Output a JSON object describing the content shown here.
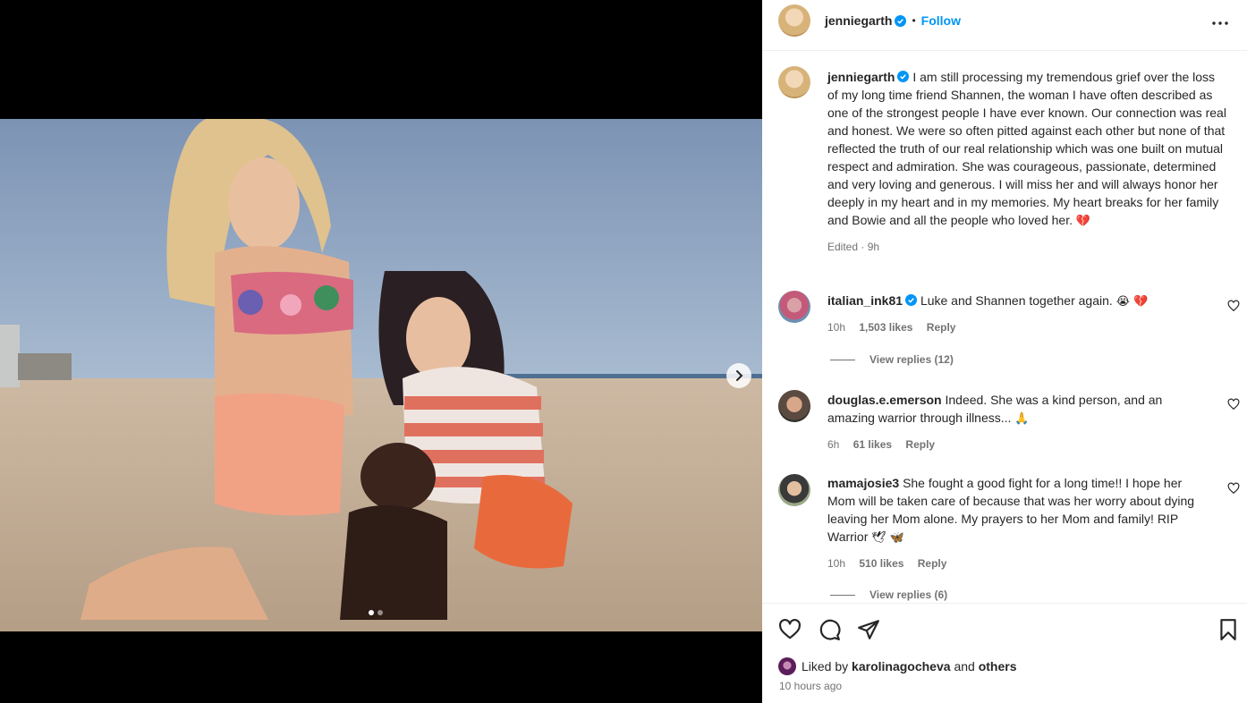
{
  "header": {
    "username": "jenniegarth",
    "separator": "•",
    "follow_label": "Follow"
  },
  "caption": {
    "username": "jenniegarth",
    "text": "I am still processing my tremendous grief over the loss of my long time friend Shannen, the woman I have often described as one of the strongest people I have ever known. Our connection was real and honest. We were so often pitted against each other but none of that reflected the truth of our real relationship which was one built on mutual respect and admiration. She was courageous, passionate, determined and very loving and generous. I will miss her and will always honor her deeply in my heart and in my memories. My heart breaks for her family and Bowie and all the people who loved her.",
    "emoji": "💔",
    "meta": "Edited · 9h"
  },
  "comments": [
    {
      "username": "italian_ink81",
      "verified": true,
      "text": "Luke and Shannen together again.",
      "emoji": "😭 💔",
      "time": "10h",
      "likes": "1,503 likes",
      "reply": "Reply",
      "view_replies": "View replies (12)"
    },
    {
      "username": "douglas.e.emerson",
      "text": "Indeed. She was a kind person, and an amazing warrior through illness...",
      "emoji": "🙏",
      "time": "6h",
      "likes": "61 likes",
      "reply": "Reply"
    },
    {
      "username": "mamajosie3",
      "text": "She fought a good fight for a long time!! I hope her Mom will be taken care of because that was her worry about dying leaving her Mom alone. My prayers to her Mom and family! RIP Warrior",
      "emoji": "🕊 🦋",
      "time": "10h",
      "likes": "510 likes",
      "reply": "Reply",
      "view_replies": "View replies (6)"
    }
  ],
  "footer": {
    "liked_by_prefix": "Liked by",
    "liked_by_user": "karolinagocheva",
    "and": "and",
    "others": "others",
    "timestamp": "10 hours ago"
  },
  "icons": {
    "verified": "verified-badge-icon",
    "more": "more-options-icon",
    "like": "heart-icon",
    "comment": "comment-icon",
    "share": "share-icon",
    "save": "bookmark-icon",
    "next": "chevron-right-icon"
  },
  "colors": {
    "accent": "#0095f6",
    "verified": "#0095f6",
    "text": "#262626",
    "muted": "#737373"
  }
}
